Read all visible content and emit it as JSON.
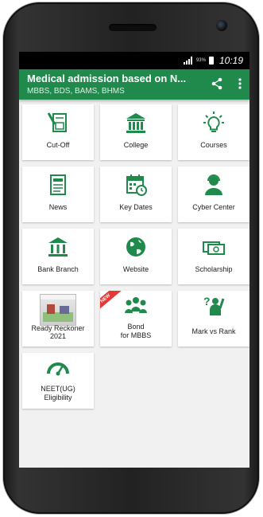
{
  "status_bar": {
    "battery": "93%",
    "time": "10:19"
  },
  "app_bar": {
    "title": "Medical admission based on N...",
    "subtitle": "MBBS, BDS, BAMS, BHMS"
  },
  "colors": {
    "primary": "#1f8a4c",
    "icon": "#1f8a4c",
    "ribbon": "#e53935"
  },
  "tiles": [
    {
      "label": "Cut-Off",
      "icon": "cutoff-document-icon"
    },
    {
      "label": "College",
      "icon": "college-building-icon"
    },
    {
      "label": "Courses",
      "icon": "lightbulb-icon"
    },
    {
      "label": "News",
      "icon": "newspaper-icon"
    },
    {
      "label": "Key Dates",
      "icon": "calendar-icon"
    },
    {
      "label": "Cyber Center",
      "icon": "support-agent-icon"
    },
    {
      "label": "Bank Branch",
      "icon": "bank-icon"
    },
    {
      "label": "Website",
      "icon": "globe-icon"
    },
    {
      "label": "Scholarship",
      "icon": "money-icon"
    },
    {
      "label": "Ready Reckoner",
      "label2": "2021",
      "icon": "book-thumbnail-icon"
    },
    {
      "label": "Bond",
      "label2": "for MBBS",
      "icon": "group-icon",
      "ribbon": "NEW"
    },
    {
      "label": "Mark vs Rank",
      "icon": "question-person-icon"
    },
    {
      "label": "NEET(UG)",
      "label2": "Eligibility",
      "icon": "speedometer-icon"
    }
  ]
}
